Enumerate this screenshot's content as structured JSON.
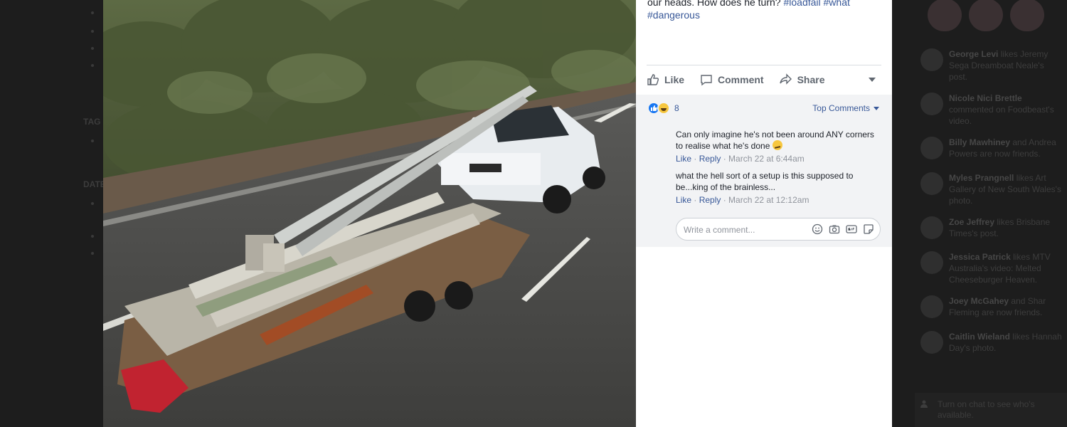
{
  "left_sidebar": {
    "tags_label": "TAG",
    "dates_label": "DATE"
  },
  "post": {
    "caption_line1": "our heads. How does he turn?",
    "hashtags_line1": [
      "#loadfail",
      "#what"
    ],
    "hashtags_line2": "#dangerous",
    "actions": {
      "like": "Like",
      "comment": "Comment",
      "share": "Share"
    },
    "reactions_count": "8",
    "top_comments_label": "Top Comments",
    "comments": [
      {
        "text": "Can only imagine he's not been around ANY corners to realise what he's done",
        "like": "Like",
        "reply": "Reply",
        "time": "March 22 at 6:44am"
      },
      {
        "text": "what the hell sort of a setup is this supposed to be...king of the brainless...",
        "like": "Like",
        "reply": "Reply",
        "time": "March 22 at 12:12am"
      }
    ],
    "write_placeholder": "Write a comment..."
  },
  "ticker": [
    {
      "name": "George Levi",
      "text": "likes Jeremy Sega Dreamboat Neale's post."
    },
    {
      "name": "Nicole Nici Brettle",
      "text": "commented on Foodbeast's video."
    },
    {
      "name": "Billy Mawhiney",
      "text": "and Andrea Powers are now friends."
    },
    {
      "name": "Myles Prangnell",
      "text": "likes Art Gallery of New South Wales's photo."
    },
    {
      "name": "Zoe Jeffrey",
      "text": "likes Brisbane Times's post."
    },
    {
      "name": "Jessica Patrick",
      "text": "likes MTV Australia's video: Melted Cheeseburger Heaven."
    },
    {
      "name": "Joey McGahey",
      "text": "and Shar Fleming are now friends."
    },
    {
      "name": "Caitlin Wieland",
      "text": "likes Hannah Day's photo."
    }
  ],
  "chat": {
    "turn_on": "Turn on chat to see who's available."
  }
}
